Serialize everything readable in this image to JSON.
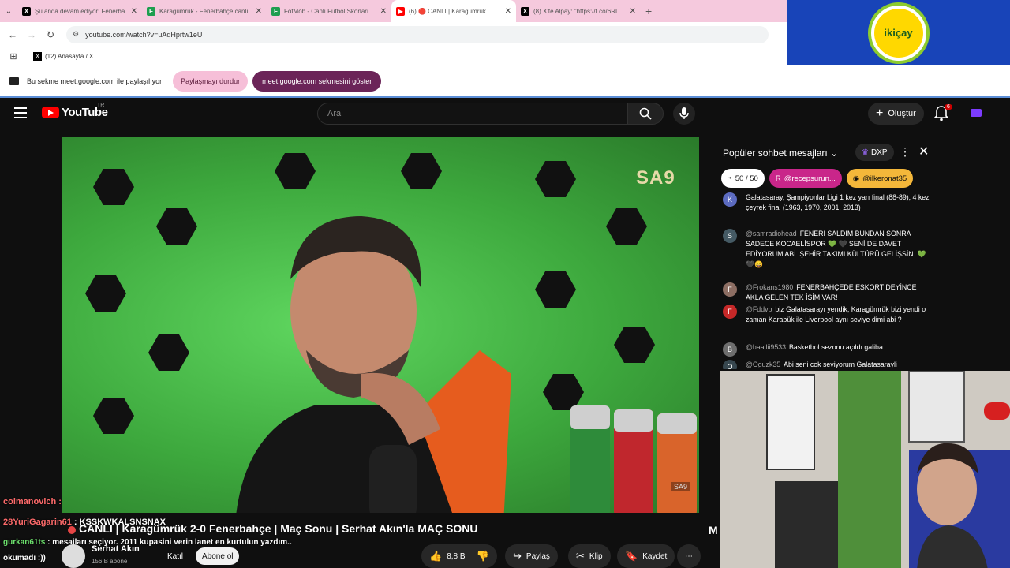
{
  "browser": {
    "tabs": [
      {
        "title": "Şu anda devam ediyor: Fenerba",
        "fav_color": "#000000",
        "fav_glyph": "X"
      },
      {
        "title": "Karagümrük - Fenerbahçe canlı",
        "fav_color": "#1e9e4f",
        "fav_glyph": "F"
      },
      {
        "title": "FotMob - Canlı Futbol Skorları",
        "fav_color": "#1e9e4f",
        "fav_glyph": "F"
      },
      {
        "title": "(6) 🔴 CANLI | Karagümrük",
        "fav_color": "#ff0000",
        "fav_glyph": "▶"
      },
      {
        "title": "(8) X'te Alpay: \"https://t.co/6RL",
        "fav_color": "#000000",
        "fav_glyph": "X"
      }
    ],
    "url": "youtube.com/watch?v=uAqHprtw1eU",
    "bookmark": "(12) Anasayfa / X"
  },
  "sharebar": {
    "text": "Bu sekme meet.google.com ile paylaşılıyor",
    "stop_label": "Paylaşmayı durdur",
    "show_label": "meet.google.com sekmesini göster"
  },
  "sponsor": {
    "logo_text": "ikiçay"
  },
  "youtube": {
    "logo": "YouTube",
    "country": "TR",
    "search_placeholder": "Ara",
    "create_label": "Oluştur",
    "notif_count": "6",
    "video_title": "CANLI | Karagümrük 2-0 Fenerbahçe | Maç Sonu | Serhat Akın'la MAÇ SONU",
    "watermark": "SA9",
    "watermark_small": "SA9",
    "channel": "Serhat Akın",
    "subs": "156 B abone",
    "join_label": "Katıl",
    "subscribe_label": "Abone ol",
    "likes": "8,8 B",
    "share_label": "Paylaş",
    "clip_label": "Klip",
    "save_label": "Kaydet"
  },
  "overlay": {
    "l1_user": "colmanovich :",
    "l2_user": "28YuriGagarin61",
    "l2_text": ": KSSKWKALSNSNAX",
    "l3_user": "gurkan61ts",
    "l3_text": ": mesajları seçiyor. 2011 kupasini verin lanet en kurtulun yazdım..",
    "l4_text": "okumadı :))",
    "side_char": "M"
  },
  "chat": {
    "title": "Popüler sohbet mesajları",
    "dxp": "DXP",
    "chips": [
      {
        "label": "50 / 50"
      },
      {
        "label": "@recepsurun..."
      },
      {
        "label": "@ilkeronat35"
      }
    ],
    "messages": [
      {
        "author": "",
        "text": "Galatasaray, Şampiyonlar Ligi 1 kez yarı final (88-89), 4 kez çeyrek final (1963, 1970, 2001, 2013)",
        "avatar": "K",
        "color": "#5c6bc0"
      },
      {
        "author": "@samradiohead",
        "text": "FENERİ SALDIM BUNDAN SONRA SADECE KOCAELİSPOR 💚 🖤 SENİ DE DAVET EDİYORUM ABİ. ŞEHİR TAKIMI KÜLTÜRÜ GELİŞSİN. 💚🖤😄",
        "avatar": "S",
        "color": "#455a64"
      },
      {
        "author": "@Frokans1980",
        "text": "FENERBAHÇEDE ESKORT DEYİNCE AKLA GELEN TEK İSİM VAR!",
        "avatar": "F",
        "color": "#8d6e63"
      },
      {
        "author": "@Fddvb",
        "text": "biz Galatasarayı yendik, Karagümrük bizi yendi o zaman Karabük ile Liverpool aynı seviye dimi abi ?",
        "avatar": "F",
        "color": "#c62828"
      },
      {
        "author": "@baallii9533",
        "text": "Basketbol sezonu açıldı galiba",
        "avatar": "B",
        "color": "#6d6d6d"
      },
      {
        "author": "@Oguzk35",
        "text": "Abi seni cok seviyorum Galatasarayli",
        "avatar": "O",
        "color": "#37474f"
      }
    ]
  }
}
